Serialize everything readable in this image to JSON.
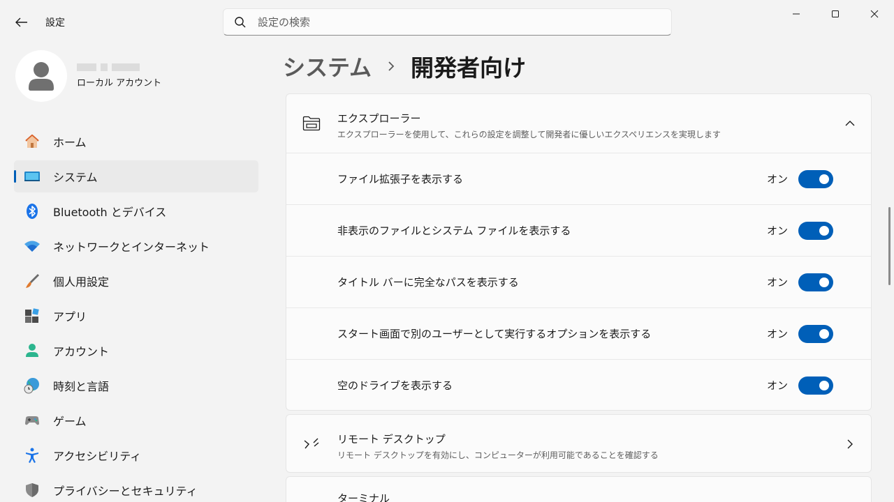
{
  "window": {
    "app_title": "設定"
  },
  "search": {
    "placeholder": "設定の検索"
  },
  "profile": {
    "account_type": "ローカル アカウント"
  },
  "nav": {
    "items": [
      {
        "label": "ホーム",
        "icon": "home-icon"
      },
      {
        "label": "システム",
        "icon": "system-icon",
        "active": true
      },
      {
        "label": "Bluetooth とデバイス",
        "icon": "bluetooth-icon"
      },
      {
        "label": "ネットワークとインターネット",
        "icon": "wifi-icon"
      },
      {
        "label": "個人用設定",
        "icon": "brush-icon"
      },
      {
        "label": "アプリ",
        "icon": "apps-icon"
      },
      {
        "label": "アカウント",
        "icon": "account-icon"
      },
      {
        "label": "時刻と言語",
        "icon": "globe-clock-icon"
      },
      {
        "label": "ゲーム",
        "icon": "gamepad-icon"
      },
      {
        "label": "アクセシビリティ",
        "icon": "accessibility-icon"
      },
      {
        "label": "プライバシーとセキュリティ",
        "icon": "shield-icon"
      }
    ]
  },
  "breadcrumb": {
    "parent": "システム",
    "current": "開発者向け"
  },
  "explorer": {
    "title": "エクスプローラー",
    "description": "エクスプローラーを使用して、これらの設定を調整して開発者に優しいエクスペリエンスを実現します",
    "settings": [
      {
        "label": "ファイル拡張子を表示する",
        "state": "オン"
      },
      {
        "label": "非表示のファイルとシステム ファイルを表示する",
        "state": "オン"
      },
      {
        "label": "タイトル バーに完全なパスを表示する",
        "state": "オン"
      },
      {
        "label": "スタート画面で別のユーザーとして実行するオプションを表示する",
        "state": "オン"
      },
      {
        "label": "空のドライブを表示する",
        "state": "オン"
      }
    ]
  },
  "remote_desktop": {
    "title": "リモート デスクトップ",
    "description": "リモート デスクトップを有効にし、コンピューターが利用可能であることを確認する"
  },
  "terminal": {
    "title": "ターミナル"
  },
  "colors": {
    "accent": "#005fb8",
    "background": "#f3f3f3",
    "card": "#fbfbfb"
  }
}
